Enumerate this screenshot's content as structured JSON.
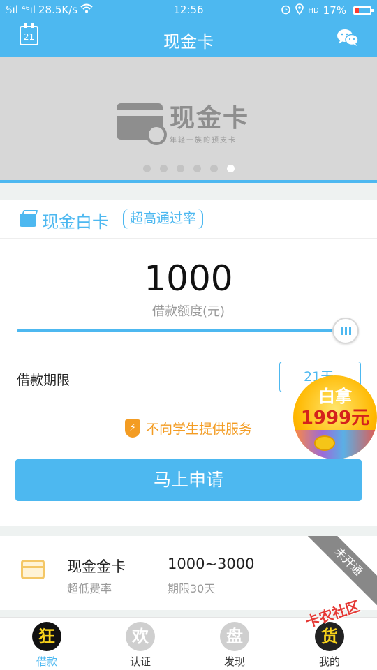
{
  "status_bar": {
    "signal": "𝕊ıl ⁴⁶ıl",
    "speed": "28.5K/s",
    "time": "12:56",
    "hd": "HD",
    "battery": "17%"
  },
  "header": {
    "title": "现金卡",
    "calendar_day": "21",
    "calendar_icon": "calendar-icon",
    "share_icon": "wechat-icon"
  },
  "banner": {
    "logo_text": "现金卡",
    "logo_slogan": "年轻一族的预支卡",
    "dot_count": 6,
    "active_dot": 6
  },
  "white_card": {
    "title": "现金白卡",
    "tag": "超高通过率"
  },
  "loan": {
    "amount": "1000",
    "amount_label": "借款额度(元)",
    "term_label": "借款期限",
    "term_value": "21天",
    "notice": "不向学生提供服务",
    "apply_button": "马上申请"
  },
  "promo": {
    "line1": "白拿",
    "line2": "1999元"
  },
  "gold_card": {
    "name": "现金金卡",
    "subtitle": "超低费率",
    "range": "1000~3000",
    "term": "期限30天",
    "ribbon": "未开通"
  },
  "tabs": [
    {
      "icon_char": "狂",
      "label": "借款",
      "active": true
    },
    {
      "icon_char": "欢",
      "label": "认证",
      "active": false
    },
    {
      "icon_char": "盘",
      "label": "发现",
      "active": false
    },
    {
      "icon_char": "货",
      "label": "我的",
      "active": false
    }
  ],
  "watermark": "卡农社区",
  "colors": {
    "primary": "#4db8f0",
    "warning": "#f39c23",
    "promo_red": "#d4221c"
  }
}
